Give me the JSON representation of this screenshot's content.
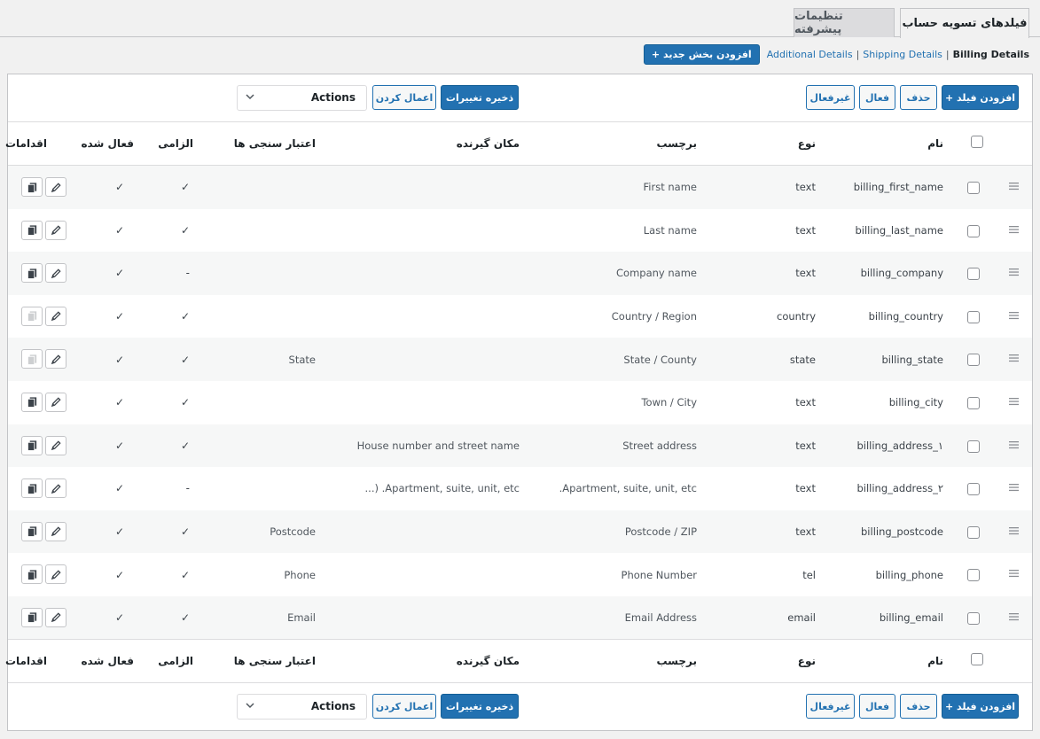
{
  "tabs": [
    {
      "label": "فیلدهای تسویه حساب",
      "active": true
    },
    {
      "label": "تنظیمات پیشرفته",
      "active": false
    }
  ],
  "sections": {
    "links": [
      "Billing Details",
      "Shipping Details",
      "Additional Details"
    ],
    "separator": "|",
    "add_label": "+ افزودن بخش جدید"
  },
  "toolbar": {
    "add_field": "+ افزودن فیلد",
    "delete": "حذف",
    "enable": "فعال",
    "disable": "غیرفعال",
    "save": "ذخیره تغییرات",
    "apply": "اعمال کردن",
    "actions": "Actions"
  },
  "columns": {
    "name": "نام",
    "type": "نوع",
    "label": "برچسب",
    "placeholder": "مکان گیرنده",
    "validation": "اعتبار سنجی ها",
    "required": "الزامی",
    "enabled": "فعال شده",
    "actions": "اقدامات"
  },
  "rows": [
    {
      "name": "billing_first_name",
      "type": "text",
      "label": "First name",
      "placeholder": "",
      "validation": "",
      "required": "✓",
      "enabled": "✓",
      "copy_enabled": true
    },
    {
      "name": "billing_last_name",
      "type": "text",
      "label": "Last name",
      "placeholder": "",
      "validation": "",
      "required": "✓",
      "enabled": "✓",
      "copy_enabled": true
    },
    {
      "name": "billing_company",
      "type": "text",
      "label": "Company name",
      "placeholder": "",
      "validation": "",
      "required": "-",
      "enabled": "✓",
      "copy_enabled": true
    },
    {
      "name": "billing_country",
      "type": "country",
      "label": "Country / Region",
      "placeholder": "",
      "validation": "",
      "required": "✓",
      "enabled": "✓",
      "copy_enabled": false
    },
    {
      "name": "billing_state",
      "type": "state",
      "label": "State / County",
      "placeholder": "",
      "validation": "State",
      "required": "✓",
      "enabled": "✓",
      "copy_enabled": false
    },
    {
      "name": "billing_city",
      "type": "text",
      "label": "Town / City",
      "placeholder": "",
      "validation": "",
      "required": "✓",
      "enabled": "✓",
      "copy_enabled": true
    },
    {
      "name": "billing_address_۱",
      "type": "text",
      "label": "Street address",
      "placeholder": "House number and street name",
      "validation": "",
      "required": "✓",
      "enabled": "✓",
      "copy_enabled": true
    },
    {
      "name": "billing_address_۲",
      "type": "text",
      "label": ".Apartment, suite, unit, etc",
      "placeholder": "...) .Apartment, suite, unit, etc",
      "validation": "",
      "required": "-",
      "enabled": "✓",
      "copy_enabled": true
    },
    {
      "name": "billing_postcode",
      "type": "text",
      "label": "Postcode / ZIP",
      "placeholder": "",
      "validation": "Postcode",
      "required": "✓",
      "enabled": "✓",
      "copy_enabled": true
    },
    {
      "name": "billing_phone",
      "type": "tel",
      "label": "Phone Number",
      "placeholder": "",
      "validation": "Phone",
      "required": "✓",
      "enabled": "✓",
      "copy_enabled": true
    },
    {
      "name": "billing_email",
      "type": "email",
      "label": "Email Address",
      "placeholder": "",
      "validation": "Email",
      "required": "✓",
      "enabled": "✓",
      "copy_enabled": true
    }
  ],
  "icons": {
    "drag": "drag-handle-icon",
    "edit": "pencil-icon",
    "copy": "copy-icon",
    "select": "chevron-down-icon"
  },
  "colors": {
    "accent": "#2271b1",
    "background": "#f1f1f1"
  }
}
